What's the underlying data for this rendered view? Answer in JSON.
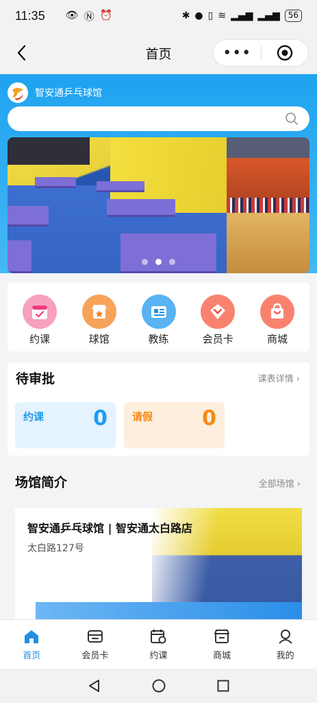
{
  "status_bar": {
    "time": "11:35",
    "battery": "56"
  },
  "nav": {
    "title": "首页",
    "more_label": "•••"
  },
  "brand": {
    "name": "智安通乒乓球馆"
  },
  "search": {
    "placeholder": ""
  },
  "banner": {
    "active_index": 1,
    "dot_count": 3
  },
  "menu": [
    {
      "label": "约课",
      "icon": "calendar-icon",
      "color": "#f03c7e"
    },
    {
      "label": "球馆",
      "icon": "store-icon",
      "color": "#f57c1f"
    },
    {
      "label": "教练",
      "icon": "coach-card-icon",
      "color": "#1f8fe6"
    },
    {
      "label": "会员卡",
      "icon": "member-card-icon",
      "color": "#f0473b"
    },
    {
      "label": "商城",
      "icon": "shopping-bag-icon",
      "color": "#f0473b"
    }
  ],
  "pending": {
    "title": "待审批",
    "link": "课表详情",
    "items": [
      {
        "label": "约课",
        "value": "0",
        "color": "#1f9bf0",
        "bg": "#e4f3fd"
      },
      {
        "label": "请假",
        "value": "0",
        "color": "#f58a16",
        "bg": "#fdeede"
      }
    ]
  },
  "venue": {
    "title": "场馆简介",
    "link": "全部场馆",
    "name": "智安通乒乓球馆 | 智安通太白路店",
    "address": "太白路127号"
  },
  "tabs": [
    {
      "label": "首页",
      "icon": "home-icon",
      "active": true
    },
    {
      "label": "会员卡",
      "icon": "card-icon",
      "active": false
    },
    {
      "label": "约课",
      "icon": "schedule-icon",
      "active": false
    },
    {
      "label": "商城",
      "icon": "shop-icon",
      "active": false
    },
    {
      "label": "我的",
      "icon": "profile-icon",
      "active": false
    }
  ],
  "colors": {
    "primary": "#1fa3f0",
    "tab_active": "#1f8fe6"
  }
}
